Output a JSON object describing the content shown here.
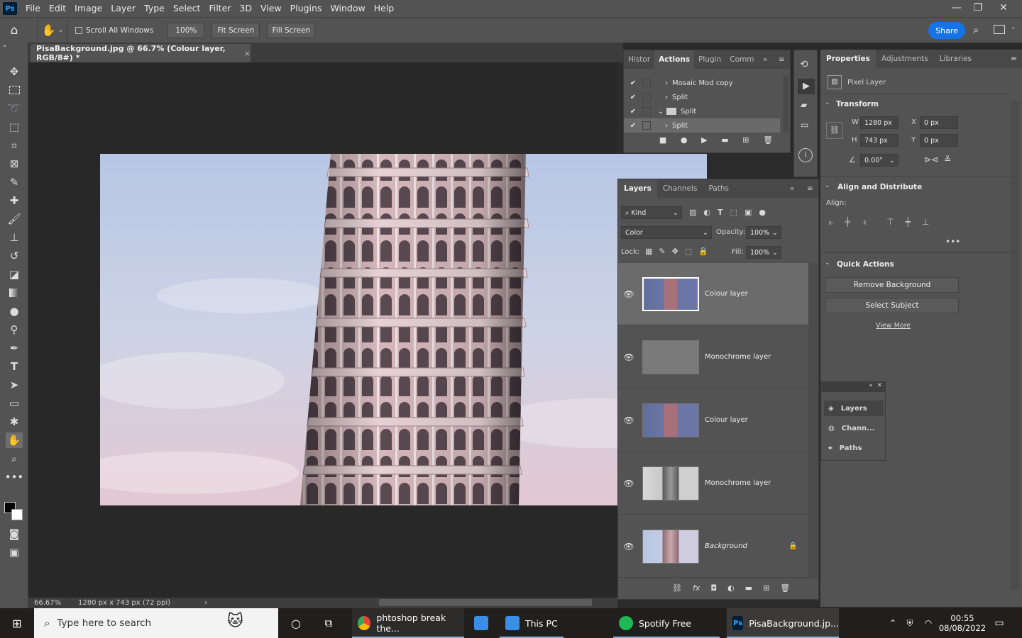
{
  "app": {
    "logo": "Ps"
  },
  "menu": [
    "File",
    "Edit",
    "Image",
    "Layer",
    "Type",
    "Select",
    "Filter",
    "3D",
    "View",
    "Plugins",
    "Window",
    "Help"
  ],
  "window_controls": {
    "minimize": "—",
    "restore": "❐",
    "close": "✕"
  },
  "options": {
    "scroll_all_windows": "Scroll All Windows",
    "zoom": "100%",
    "fit_screen": "Fit Screen",
    "fill_screen": "Fill Screen",
    "share": "Share"
  },
  "document": {
    "tab_title": "PisaBackground.jpg @ 66.7% (Colour layer, RGB/8#) *",
    "zoom": "66.67%",
    "dimensions": "1280 px x 743 px (72 ppi)"
  },
  "actions_panel": {
    "tabs": [
      "Histor",
      "Actions",
      "Plugin",
      "Comm"
    ],
    "active_tab": "Actions",
    "items": [
      {
        "label": "Mosaic Mod copy"
      },
      {
        "label": "Split"
      },
      {
        "label": "Split"
      },
      {
        "label": "Split"
      }
    ]
  },
  "layers_panel": {
    "tabs": [
      "Layers",
      "Channels",
      "Paths"
    ],
    "active_tab": "Layers",
    "filter": "Kind",
    "blend_mode": "Color",
    "opacity_label": "Opacity:",
    "opacity": "100%",
    "lock_label": "Lock:",
    "fill_label": "Fill:",
    "fill": "100%",
    "layers": [
      {
        "name": "Colour layer",
        "selected": true
      },
      {
        "name": "Monochrome layer",
        "selected": false
      },
      {
        "name": "Colour layer",
        "selected": false
      },
      {
        "name": "Monochrome layer",
        "selected": false
      },
      {
        "name": "Background",
        "selected": false,
        "locked": true
      }
    ]
  },
  "properties": {
    "tabs": [
      "Properties",
      "Adjustments",
      "Libraries"
    ],
    "active_tab": "Properties",
    "kind": "Pixel Layer",
    "transform_title": "Transform",
    "w_label": "W",
    "w": "1280 px",
    "h_label": "H",
    "h": "743 px",
    "x_label": "X",
    "x": "0 px",
    "y_label": "Y",
    "y": "0 px",
    "angle": "0.00°",
    "align_title": "Align and Distribute",
    "align_label": "Align:",
    "quick_title": "Quick Actions",
    "remove_bg": "Remove Background",
    "select_subject": "Select Subject",
    "view_more": "View More"
  },
  "mini_panel": {
    "items": [
      "Layers",
      "Chann...",
      "Paths"
    ]
  },
  "taskbar": {
    "search_placeholder": "Type here to search",
    "chrome": "phtoshop break the...",
    "this_pc": "This PC",
    "spotify": "Spotify Free",
    "photoshop": "PisaBackground.jp...",
    "time": "00:55",
    "date": "08/08/2022"
  },
  "colors": {
    "accent": "#1473e6",
    "ps_blue": "#31a8ff",
    "spotify": "#1db954"
  }
}
